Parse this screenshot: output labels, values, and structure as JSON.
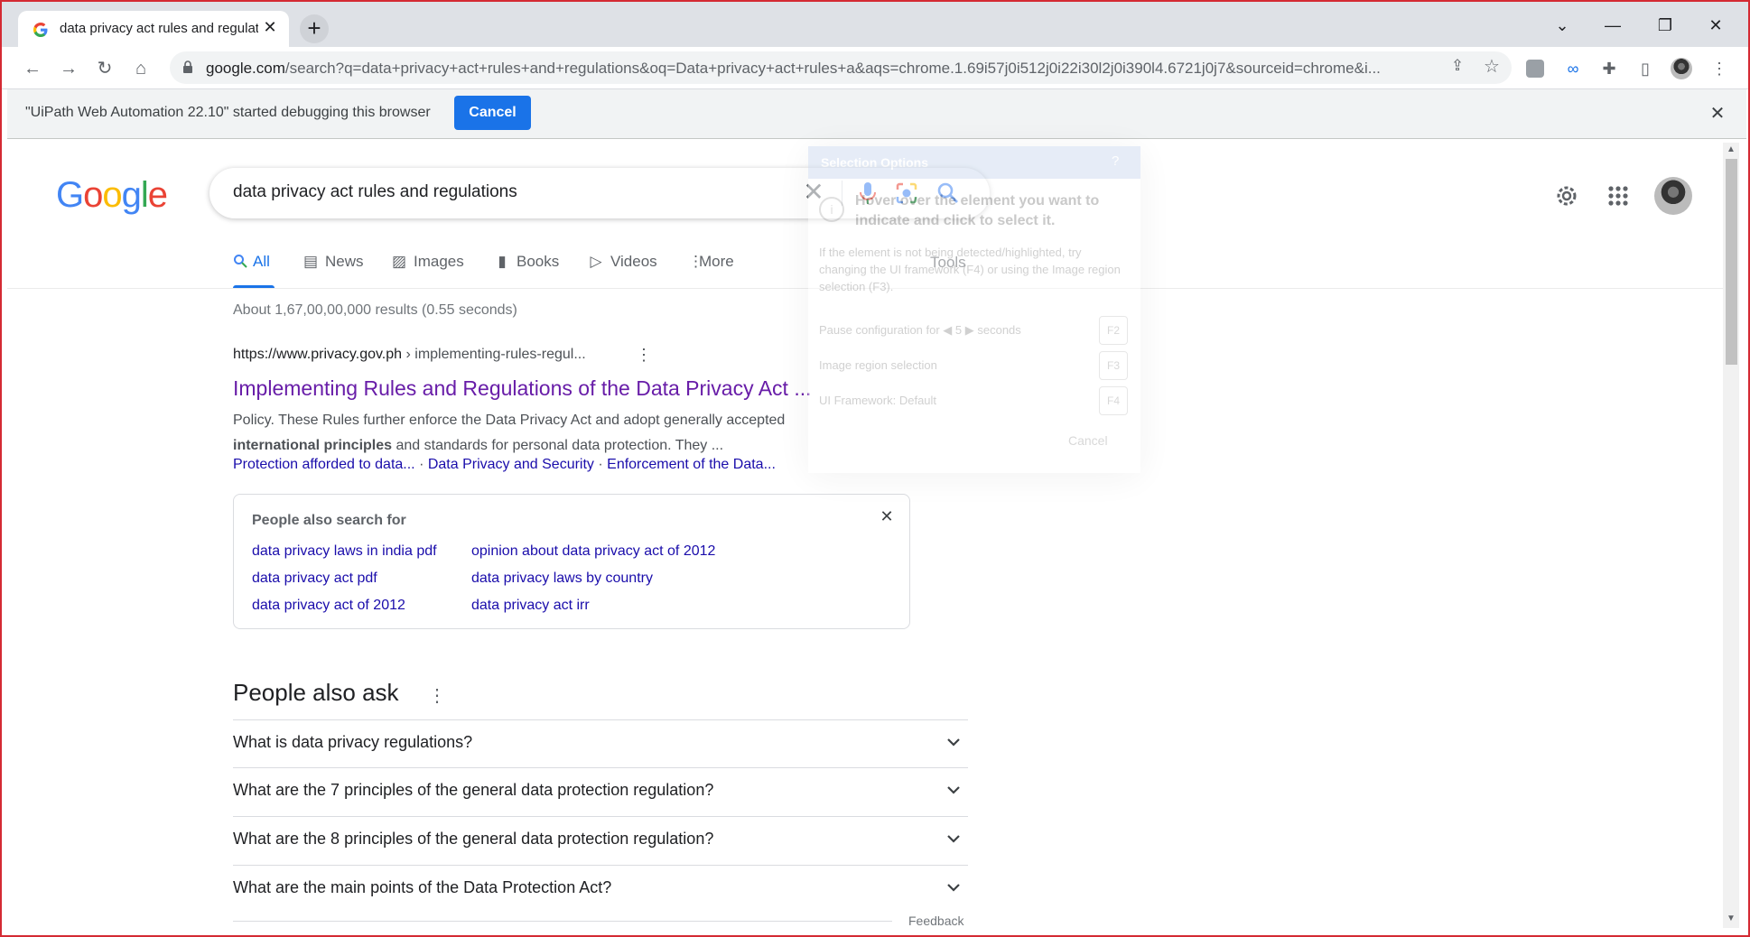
{
  "browser": {
    "tab_title": "data privacy act rules and regulat",
    "tab_close": "✕",
    "new_tab": "+",
    "url_host": "google.com",
    "url_path": "/search?q=data+privacy+act+rules+and+regulations&oq=Data+privacy+act+rules+a&aqs=chrome.1.69i57j0i512j0i22i30l2j0i390l4.6721j0j7&sourceid=chrome&i...",
    "window_controls": [
      "⌄",
      "—",
      "❐",
      "✕"
    ]
  },
  "infobar": {
    "message": "\"UiPath Web Automation 22.10\" started debugging this browser",
    "cancel_label": "Cancel",
    "close": "✕"
  },
  "google": {
    "logo": [
      "G",
      "o",
      "o",
      "g",
      "l",
      "e"
    ],
    "logo_colors": [
      "#4285f4",
      "#ea4335",
      "#fbbc05",
      "#4285f4",
      "#34a853",
      "#ea4335"
    ],
    "query": "data privacy act rules and regulations",
    "clear": "✕"
  },
  "nav": {
    "tabs": [
      {
        "label": "All",
        "icon": "search-icon"
      },
      {
        "label": "News",
        "icon": "news-icon"
      },
      {
        "label": "Images",
        "icon": "image-icon"
      },
      {
        "label": "Books",
        "icon": "book-icon"
      },
      {
        "label": "Videos",
        "icon": "video-icon"
      },
      {
        "label": "More",
        "icon": "more-vert-icon"
      }
    ],
    "tools": "Tools"
  },
  "result_stats": "About 1,67,00,00,000 results (0.55 seconds)",
  "result": {
    "cite_url": "https://www.privacy.gov.ph",
    "cite_path": " › implementing-rules-regul...",
    "title": "Implementing Rules and Regulations of the Data Privacy Act ...",
    "snippet_1": "Policy. These Rules further enforce the Data Privacy Act and adopt generally accepted",
    "snippet_bold": "international principles",
    "snippet_2": " and standards for personal data protection. They ...",
    "sitelinks": [
      "Protection afforded to data...",
      "Data Privacy and Security",
      "Enforcement of the Data..."
    ],
    "sitelink_sep": " · "
  },
  "pasf": {
    "title": "People also search for",
    "close": "✕",
    "links": [
      "data privacy laws in india pdf",
      "opinion about data privacy act of 2012",
      "data privacy act pdf",
      "data privacy laws by country",
      "data privacy act of 2012",
      "data privacy act irr"
    ]
  },
  "paa": {
    "title": "People also ask",
    "questions": [
      "What is data privacy regulations?",
      "What are the 7 principles of the general data protection regulation?",
      "What are the 8 principles of the general data protection regulation?",
      "What are the main points of the Data Protection Act?"
    ],
    "feedback": "Feedback"
  },
  "selection_overlay": {
    "title": "Selection Options",
    "help": "?",
    "info_icon": "i",
    "main": "Hover over the element you want to indicate and click to select it.",
    "sub": "If the element is not being detected/highlighted, try changing the UI framework (F4) or using the Image region selection (F3).",
    "pause": "Pause configuration for ◀ 5 ▶ seconds",
    "image_region": "Image region selection",
    "framework": "UI Framework: Default",
    "keys": [
      "F2",
      "F3",
      "F4"
    ],
    "cancel": "Cancel"
  }
}
